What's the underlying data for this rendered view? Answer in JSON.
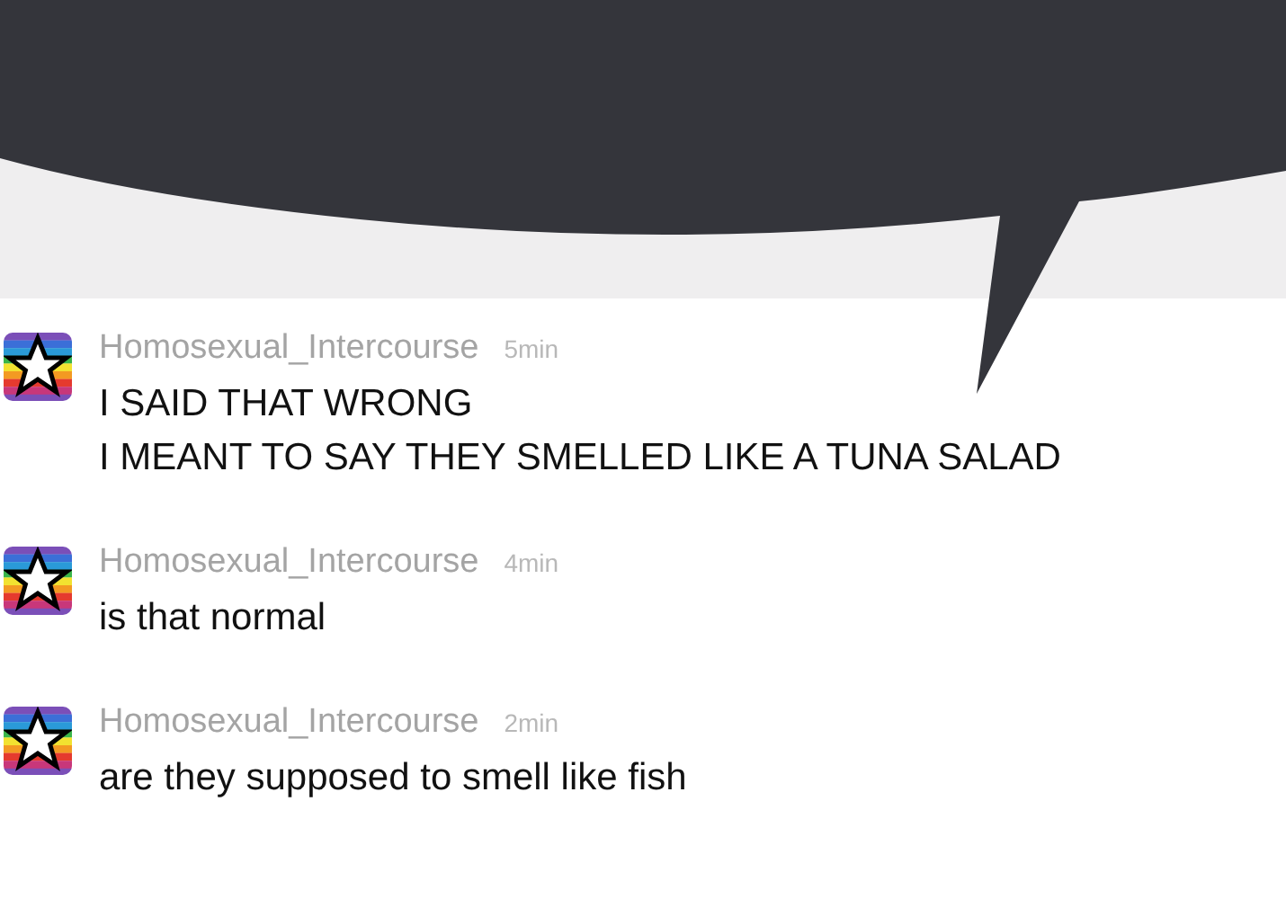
{
  "messages": [
    {
      "username": "Homosexual_Intercourse",
      "time": "5min",
      "lines": [
        "I SAID THAT WRONG",
        "I MEANT TO SAY THEY SMELLED LIKE A TUNA SALAD"
      ]
    },
    {
      "username": "Homosexual_Intercourse",
      "time": "4min",
      "lines": [
        "is that normal"
      ]
    },
    {
      "username": "Homosexual_Intercourse",
      "time": "2min",
      "lines": [
        "are they supposed to smell like fish"
      ]
    }
  ]
}
